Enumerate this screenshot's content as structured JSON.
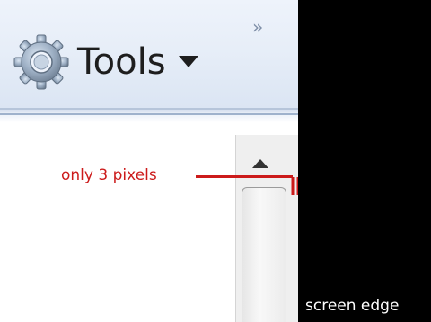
{
  "toolbar": {
    "tools_label": "Tools",
    "overflow_chevron": "»",
    "colors": {
      "background": "#e7eef8",
      "separator": "#9fb2cc"
    }
  },
  "icons": {
    "tools": "gear-icon",
    "tools_dropdown": "chevron-down-icon",
    "scroll_up": "arrow-up-icon"
  },
  "annotation": {
    "label": "only 3 pixels",
    "color": "#cc1b1b"
  },
  "screen": {
    "edge_label": "screen edge"
  }
}
